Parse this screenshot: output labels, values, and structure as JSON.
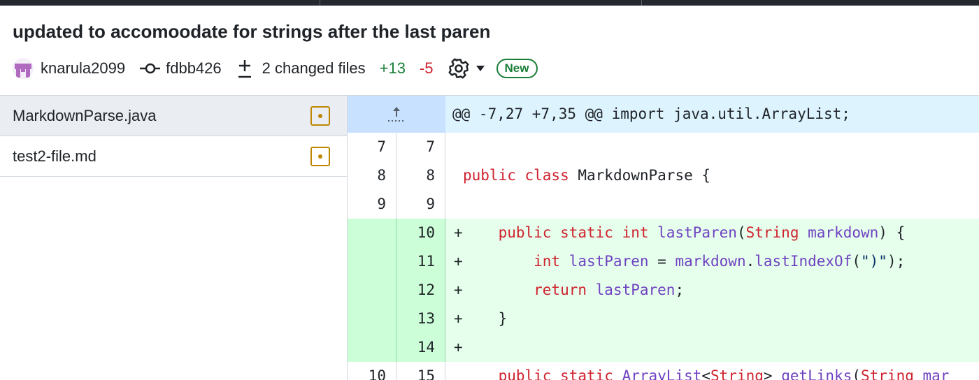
{
  "commit": {
    "title": "updated to accomoodate for strings after the last paren",
    "author": "knarula2099",
    "sha": "fdbb426",
    "changed_files": "2 changed files",
    "additions": "+13",
    "deletions": "-5",
    "badge": "New"
  },
  "files": [
    {
      "name": "MarkdownParse.java",
      "status": "modified",
      "active": true
    },
    {
      "name": "test2-file.md",
      "status": "modified",
      "active": false
    }
  ],
  "diff": {
    "hunk_header": "@@ -7,27 +7,35 @@ import java.util.ArrayList;",
    "lines": [
      {
        "old": "7",
        "new": "7",
        "type": "context",
        "marker": " ",
        "tokens": [
          {
            "t": "",
            "c": "id"
          }
        ]
      },
      {
        "old": "8",
        "new": "8",
        "type": "context",
        "marker": " ",
        "tokens": [
          {
            "t": "public class ",
            "c": "kw"
          },
          {
            "t": "MarkdownParse {",
            "c": "id"
          }
        ]
      },
      {
        "old": "9",
        "new": "9",
        "type": "context",
        "marker": " ",
        "tokens": [
          {
            "t": "",
            "c": "id"
          }
        ]
      },
      {
        "old": "",
        "new": "10",
        "type": "add",
        "marker": "+",
        "tokens": [
          {
            "t": "    public static int ",
            "c": "kw"
          },
          {
            "t": "lastParen",
            "c": "fn"
          },
          {
            "t": "(",
            "c": "id"
          },
          {
            "t": "String",
            "c": "kw"
          },
          {
            "t": " ",
            "c": "id"
          },
          {
            "t": "markdown",
            "c": "fn"
          },
          {
            "t": ") {",
            "c": "id"
          }
        ]
      },
      {
        "old": "",
        "new": "11",
        "type": "add",
        "marker": "+",
        "tokens": [
          {
            "t": "        int ",
            "c": "kw"
          },
          {
            "t": "lastParen",
            "c": "fn"
          },
          {
            "t": " = ",
            "c": "id"
          },
          {
            "t": "markdown",
            "c": "fn"
          },
          {
            "t": ".",
            "c": "id"
          },
          {
            "t": "lastIndexOf",
            "c": "fn"
          },
          {
            "t": "(",
            "c": "id"
          },
          {
            "t": "\")\"",
            "c": "st"
          },
          {
            "t": ");",
            "c": "id"
          }
        ]
      },
      {
        "old": "",
        "new": "12",
        "type": "add",
        "marker": "+",
        "tokens": [
          {
            "t": "        return ",
            "c": "kw"
          },
          {
            "t": "lastParen",
            "c": "fn"
          },
          {
            "t": ";",
            "c": "id"
          }
        ]
      },
      {
        "old": "",
        "new": "13",
        "type": "add",
        "marker": "+",
        "tokens": [
          {
            "t": "    }",
            "c": "id"
          }
        ]
      },
      {
        "old": "",
        "new": "14",
        "type": "add",
        "marker": "+",
        "tokens": [
          {
            "t": "",
            "c": "id"
          }
        ]
      },
      {
        "old": "10",
        "new": "15",
        "type": "context",
        "marker": " ",
        "tokens": [
          {
            "t": "    public static ",
            "c": "kw"
          },
          {
            "t": "ArrayList",
            "c": "fn"
          },
          {
            "t": "<",
            "c": "id"
          },
          {
            "t": "String",
            "c": "kw"
          },
          {
            "t": "> ",
            "c": "id"
          },
          {
            "t": "getLinks",
            "c": "fn"
          },
          {
            "t": "(",
            "c": "id"
          },
          {
            "t": "String",
            "c": "kw"
          },
          {
            "t": " mar",
            "c": "fn"
          }
        ]
      }
    ]
  },
  "colors": {
    "additions": "#1a7f37",
    "deletions": "#cf222e",
    "modified": "#bf8700"
  }
}
